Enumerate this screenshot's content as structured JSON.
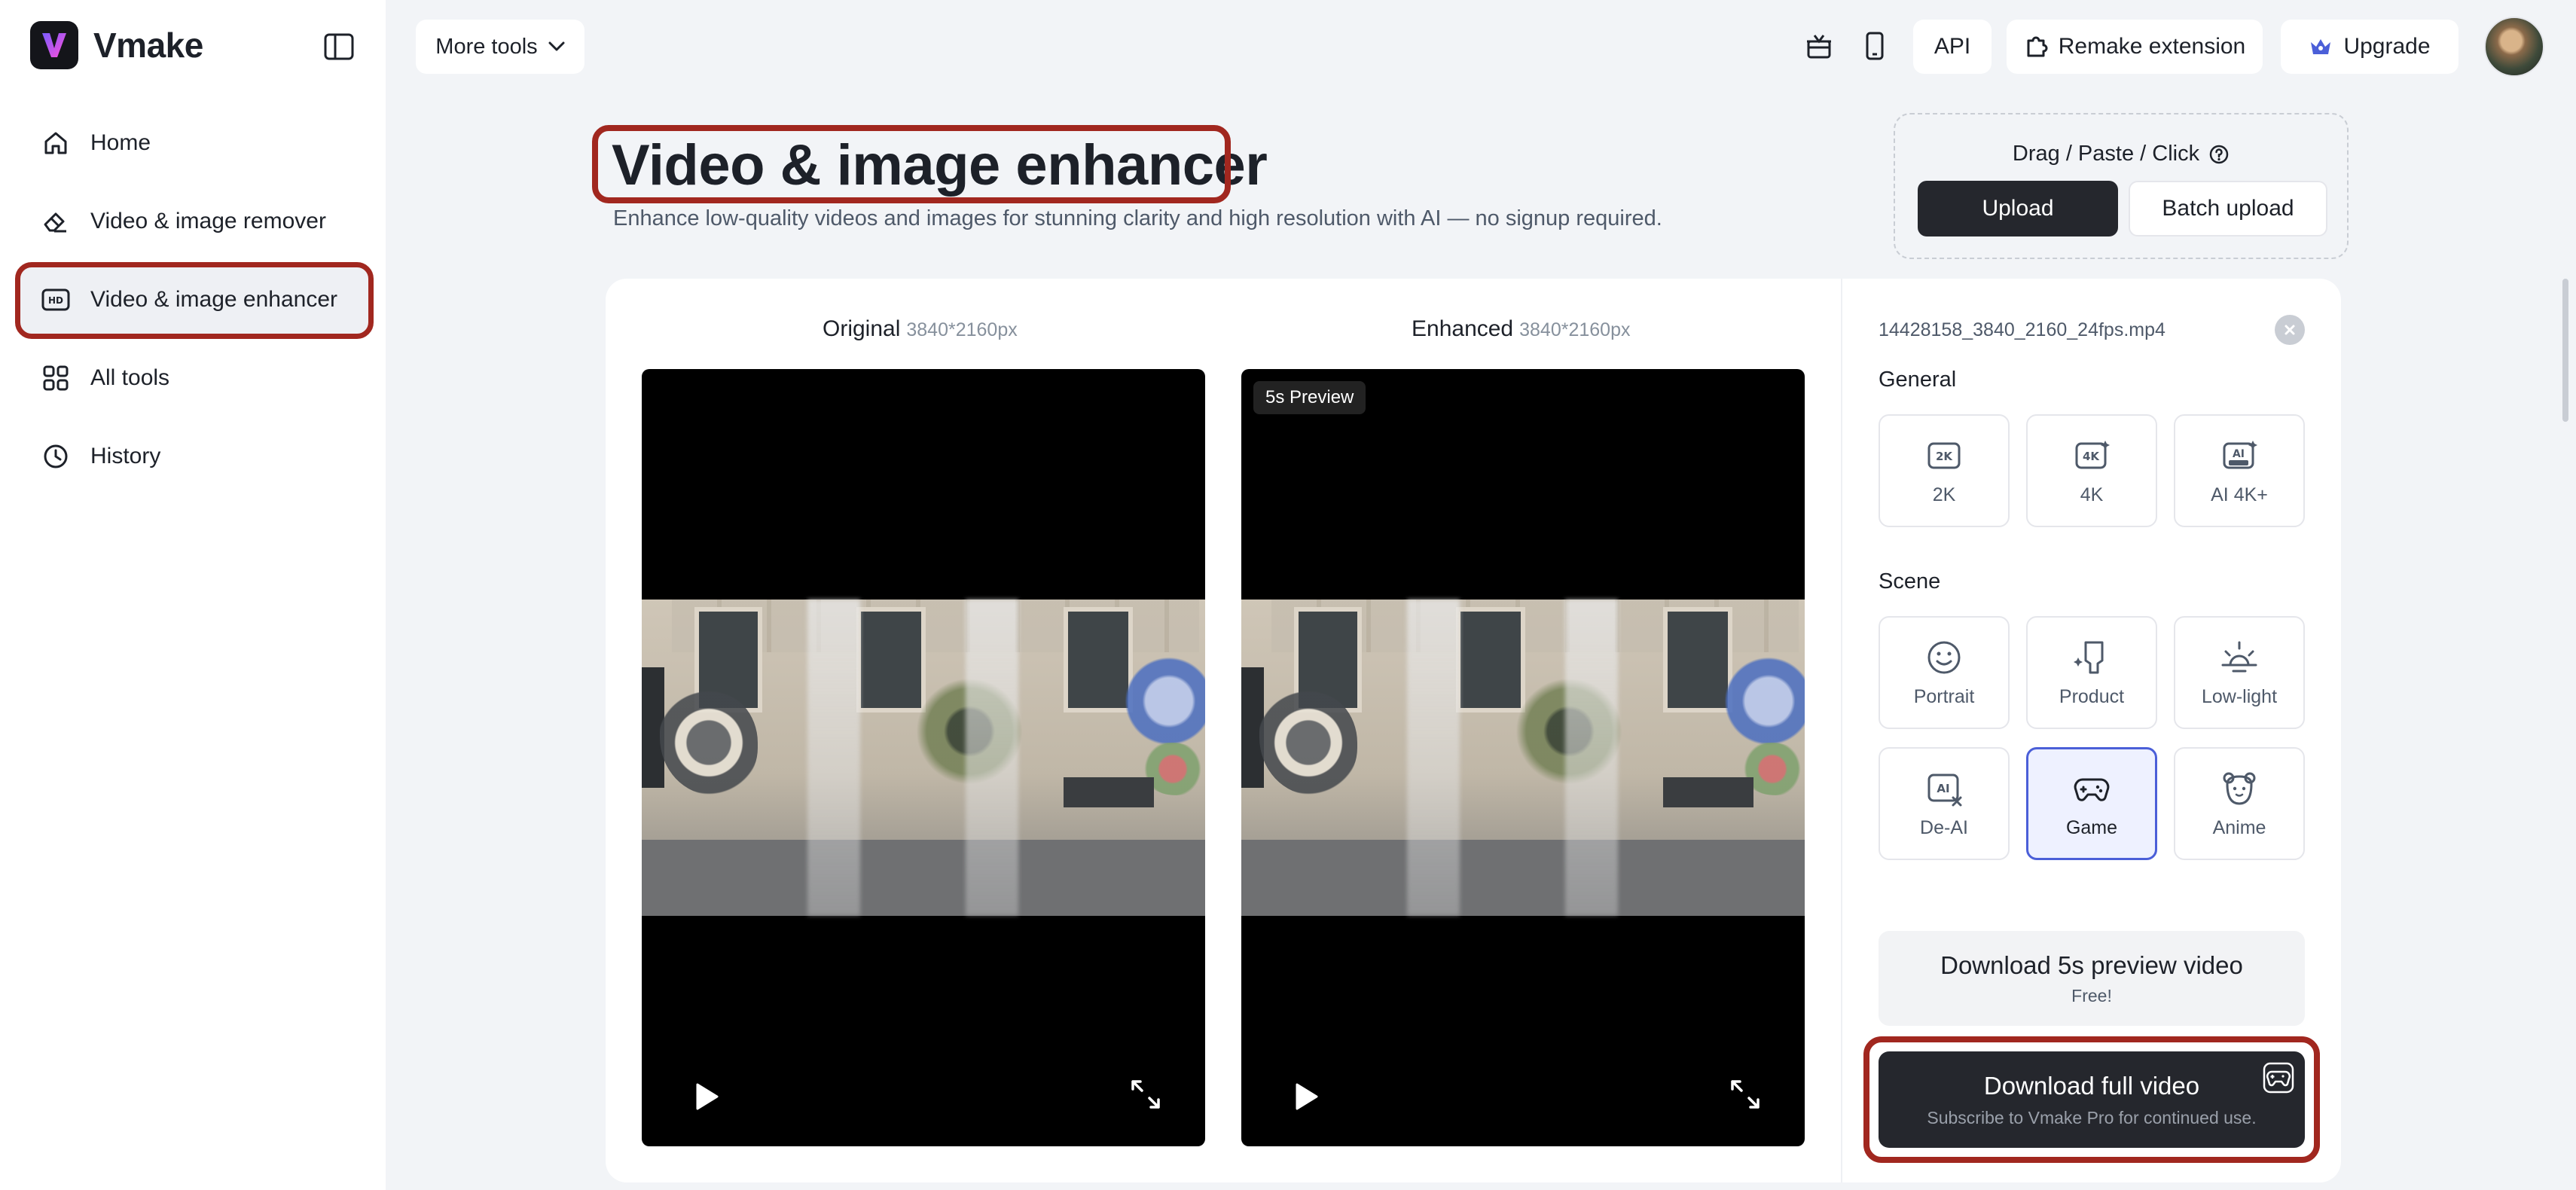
{
  "brand": {
    "name": "Vmake"
  },
  "sidebar": {
    "items": [
      {
        "label": "Home",
        "icon": "home-icon"
      },
      {
        "label": "Video & image remover",
        "icon": "eraser-icon"
      },
      {
        "label": "Video & image enhancer",
        "icon": "hd-icon",
        "active": true
      },
      {
        "label": "All tools",
        "icon": "grid-icon"
      },
      {
        "label": "History",
        "icon": "clock-icon"
      }
    ]
  },
  "topbar": {
    "more_tools": "More tools",
    "api": "API",
    "remake_extension": "Remake extension",
    "upgrade": "Upgrade"
  },
  "page": {
    "title": "Video & image enhancer",
    "subtitle": "Enhance low-quality videos and images for stunning clarity and high resolution with AI — no signup required."
  },
  "upload": {
    "hint": "Drag / Paste / Click",
    "upload_label": "Upload",
    "batch_label": "Batch upload"
  },
  "compare": {
    "original_label": "Original",
    "original_dim": "3840*2160px",
    "enhanced_label": "Enhanced",
    "enhanced_dim": "3840*2160px",
    "preview_badge": "5s Preview"
  },
  "panel": {
    "file_name": "14428158_3840_2160_24fps.mp4",
    "general_label": "General",
    "general_options": [
      "2K",
      "4K",
      "AI 4K+"
    ],
    "scene_label": "Scene",
    "scene_options": [
      "Portrait",
      "Product",
      "Low-light",
      "De-AI",
      "Game",
      "Anime"
    ],
    "selected_scene": "Game",
    "download_preview_title": "Download 5s preview video",
    "download_preview_sub": "Free!",
    "download_full_title": "Download full video",
    "download_full_sub": "Subscribe to Vmake Pro for continued use."
  },
  "colors": {
    "highlight": "#a1271f",
    "accent": "#4b5fd8",
    "dark_button": "#25272d"
  }
}
